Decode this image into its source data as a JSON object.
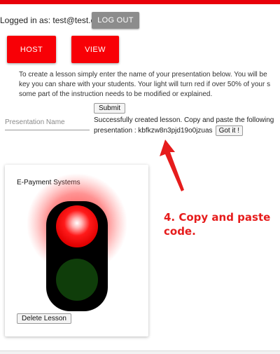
{
  "header": {
    "login_label": "Logged in as: test@test.com",
    "logout_label": "LOG OUT"
  },
  "nav": {
    "host_label": "HOST",
    "view_label": "VIEW"
  },
  "instructions": {
    "line1": "To create a lesson simply enter the name of your presentation below. You will be",
    "line2": "key you can share with your students. Your light will turn red if over 50% of your s",
    "line3": "some part of the instruction needs to be modified or explained."
  },
  "form": {
    "presentation_placeholder": "Presentation Name",
    "presentation_value": "",
    "submit_label": "Submit"
  },
  "success": {
    "line1": "Successfully created lesson. Copy and paste the following",
    "line2": "presentation : kbfkzw8n3pjd19o0jzuas",
    "got_it_label": "Got it !"
  },
  "lesson": {
    "title": "E-Payment Systems",
    "delete_label": "Delete Lesson",
    "light_state": "red"
  },
  "annotation": {
    "line1": "4. Copy and paste",
    "line2": "code."
  },
  "colors": {
    "brand_red": "#f80006",
    "annotation_red": "#e61c1c",
    "logout_gray": "#8c8c8c"
  }
}
